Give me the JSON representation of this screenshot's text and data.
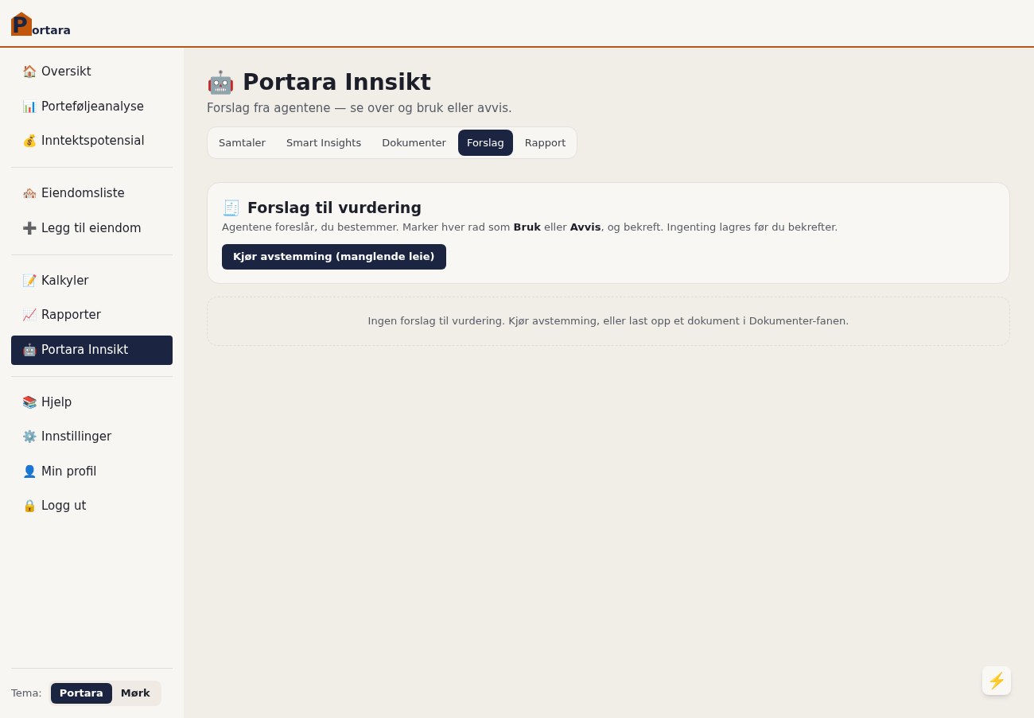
{
  "brand": {
    "mark_letter": "P",
    "name": "ortara"
  },
  "sidebar": {
    "groups": [
      [
        {
          "icon": "🏠",
          "label": "Oversikt",
          "selected": false
        },
        {
          "icon": "📊",
          "label": "Porteføljeanalyse",
          "selected": false
        },
        {
          "icon": "💰",
          "label": "Inntektspotensial",
          "selected": false
        }
      ],
      [
        {
          "icon": "🏘️",
          "label": "Eiendomsliste",
          "selected": false
        },
        {
          "icon": "➕",
          "label": "Legg til eiendom",
          "selected": false
        }
      ],
      [
        {
          "icon": "📝",
          "label": "Kalkyler",
          "selected": false
        },
        {
          "icon": "📈",
          "label": "Rapporter",
          "selected": false
        },
        {
          "icon": "🤖",
          "label": "Portara Innsikt",
          "selected": true
        }
      ],
      [
        {
          "icon": "📚",
          "label": "Hjelp",
          "selected": false
        },
        {
          "icon": "⚙️",
          "label": "Innstillinger",
          "selected": false
        },
        {
          "icon": "👤",
          "label": "Min profil",
          "selected": false
        },
        {
          "icon": "🔒",
          "label": "Logg ut",
          "selected": false
        }
      ]
    ],
    "theme": {
      "label": "Tema:",
      "options": [
        {
          "label": "Portara",
          "selected": true
        },
        {
          "label": "Mørk",
          "selected": false
        }
      ]
    }
  },
  "page": {
    "icon": "🤖",
    "title": "Portara Innsikt",
    "subtitle": "Forslag fra agentene — se over og bruk eller avvis."
  },
  "tabs": [
    {
      "label": "Samtaler",
      "selected": false
    },
    {
      "label": "Smart Insights",
      "selected": false
    },
    {
      "label": "Dokumenter",
      "selected": false
    },
    {
      "label": "Forslag",
      "selected": true
    },
    {
      "label": "Rapport",
      "selected": false
    }
  ],
  "review_card": {
    "icon": "🧾",
    "title": "Forslag til vurdering",
    "description": "Agentene foreslår, du bestemmer. Marker hver rad som **Bruk** eller **Avvis**, og bekreft. Ingenting lagres før du bekrefter.",
    "button": "Kjør avstemming (manglende leie)"
  },
  "empty_state": "Ingen forslag til vurdering. Kjør avstemming, eller last opp et dokument i Dokumenter-fanen.",
  "quick_action": {
    "icon": "⚡️"
  }
}
